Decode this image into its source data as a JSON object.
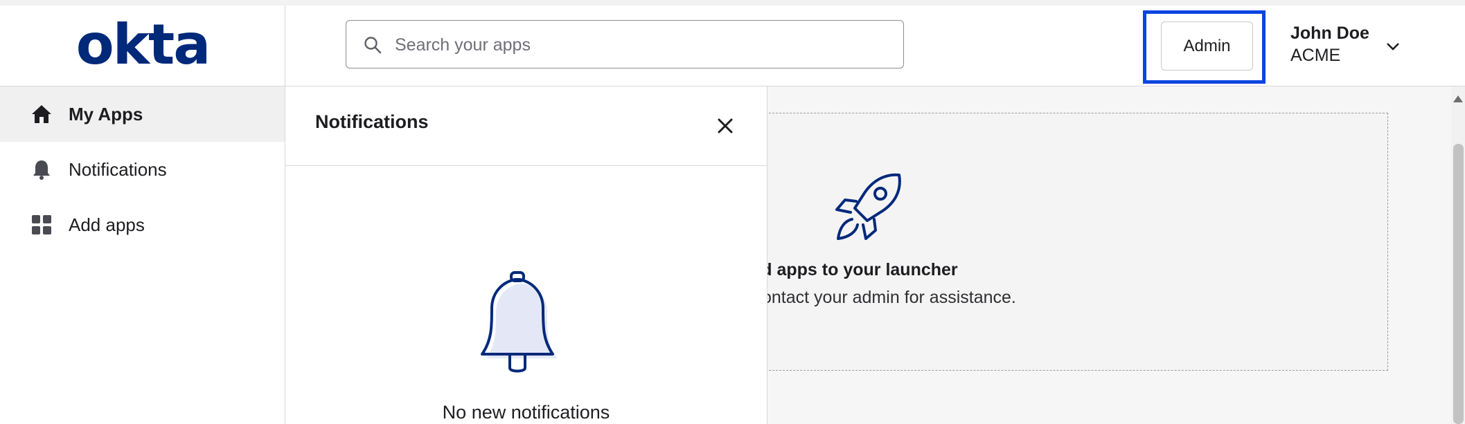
{
  "brand": {
    "logo_text": "okta",
    "color": "#00297a"
  },
  "search": {
    "placeholder": "Search your apps",
    "icon": "search-icon"
  },
  "header": {
    "admin_label": "Admin",
    "highlight_color": "#0b44e0",
    "user": {
      "name": "John Doe",
      "org": "ACME"
    }
  },
  "sidebar": {
    "items": [
      {
        "label": "My Apps",
        "icon": "home-icon",
        "active": true
      },
      {
        "label": "Notifications",
        "icon": "bell-icon",
        "active": false
      },
      {
        "label": "Add apps",
        "icon": "grid-icon",
        "active": false
      }
    ]
  },
  "main": {
    "empty_title": "dd apps to your launcher",
    "empty_subtitle": "ontact your admin for assistance."
  },
  "notifications": {
    "title": "Notifications",
    "empty_text": "No new notifications"
  }
}
